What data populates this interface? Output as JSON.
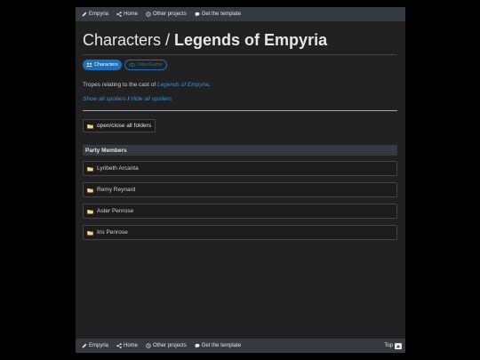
{
  "nav": {
    "items": [
      {
        "label": "Empyria",
        "icon": "pencil-icon"
      },
      {
        "label": "Home",
        "icon": "share-icon"
      },
      {
        "label": "Other projects",
        "icon": "history-icon"
      },
      {
        "label": "Get the template",
        "icon": "comment-icon"
      }
    ],
    "top_label": "Top"
  },
  "header": {
    "title_prefix": "Characters / ",
    "title_bold": "Legends of Empyria"
  },
  "tags": [
    {
      "label": "Characters",
      "icon": "users-icon",
      "style": "primary"
    },
    {
      "label": "VideoGame",
      "icon": "eye-icon",
      "style": "outline"
    }
  ],
  "description": {
    "text": "Tropes relating to the cast of ",
    "link": "Legends of Empyria",
    "suffix": "."
  },
  "spoilers": {
    "show": "Show all spoilers",
    "separator": " / ",
    "hide": "Hide all spoilers"
  },
  "folder_toggle": "open/close all folders",
  "section": {
    "title": "Party Members",
    "folders": [
      "Lyribeth Arcanta",
      "Remy Reynard",
      "Aster Penrose",
      "Iris Penrose"
    ]
  },
  "colors": {
    "background": "#000000",
    "panel": "#212121",
    "navbar": "#343a40",
    "accent": "#1e6fb8",
    "link": "#3b8fd9",
    "folder_icon": "#f0d48a"
  }
}
